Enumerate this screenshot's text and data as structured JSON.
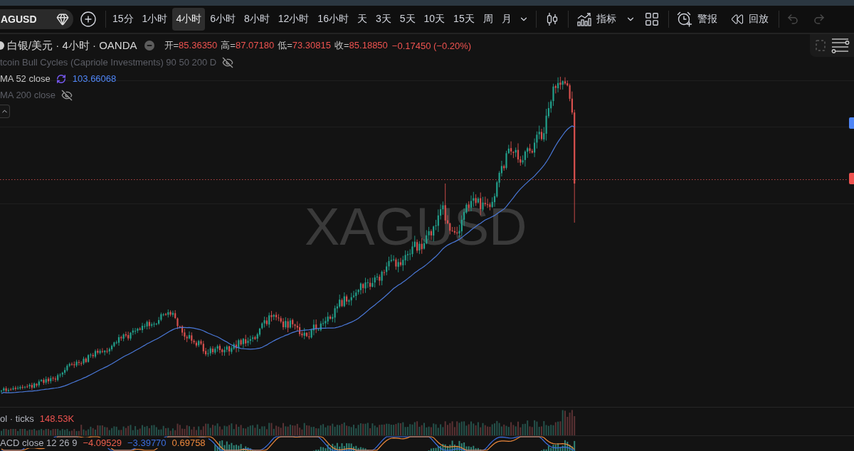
{
  "toolbar": {
    "symbol": "AGUSD",
    "intervals": [
      {
        "label": "15分",
        "selected": false
      },
      {
        "label": "1小时",
        "selected": false
      },
      {
        "label": "4小时",
        "selected": true
      },
      {
        "label": "6小时",
        "selected": false
      },
      {
        "label": "8小时",
        "selected": false
      },
      {
        "label": "12小时",
        "selected": false
      },
      {
        "label": "16小时",
        "selected": false
      },
      {
        "label": "天",
        "selected": false
      },
      {
        "label": "3天",
        "selected": false
      },
      {
        "label": "5天",
        "selected": false
      },
      {
        "label": "10天",
        "selected": false
      },
      {
        "label": "15天",
        "selected": false
      },
      {
        "label": "周",
        "selected": false
      },
      {
        "label": "月",
        "selected": false
      }
    ],
    "indicators": {
      "label": "指标"
    },
    "alert": {
      "label": "警报"
    },
    "replay": {
      "label": "回放"
    },
    "undo": {
      "disabled": true
    },
    "redo": {
      "disabled": true
    }
  },
  "legend": {
    "title": "白银/美元 · 4小时 · OANDA",
    "ohlc": [
      {
        "label": "开=",
        "value": "85.36350"
      },
      {
        "label": "高=",
        "value": "87.07180"
      },
      {
        "label": "低=",
        "value": "73.30815"
      },
      {
        "label": "收=",
        "value": "85.18850"
      }
    ],
    "change": "−0.17450 (−0.20%)",
    "indicators": [
      {
        "name": "tcoin Bull Cycles (Capriole Investments) 90 50 200 D",
        "hidden": true
      },
      {
        "name": "MA 52 close",
        "hidden": false,
        "value": "103.66068"
      },
      {
        "name": "MA 200 close",
        "hidden": true
      }
    ],
    "expanded": true
  },
  "chart": {
    "watermark": "XAGUSD"
  },
  "volume": {
    "label": "ol · ticks",
    "value": "148.53K"
  },
  "macd": {
    "label": "ACD close 12 26 9",
    "values": [
      {
        "text": "−4.09529",
        "color": "#f0604d"
      },
      {
        "text": "−3.39770",
        "color": "#3c6fe0"
      },
      {
        "text": "0.69758",
        "color": "#f08a3c"
      }
    ]
  }
}
